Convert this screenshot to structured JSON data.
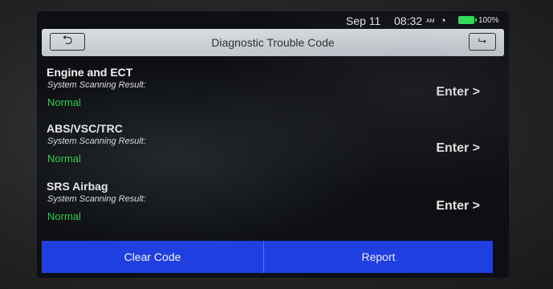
{
  "status": {
    "date": "Sep 11",
    "time": "08:32",
    "ampm": "AM",
    "wifi_icon": "wifi-icon",
    "battery_percent": "100%",
    "battery_color": "#2ee05a"
  },
  "header": {
    "title": "Diagnostic Trouble Code",
    "back_icon": "back-arrow-icon",
    "exit_icon": "exit-icon"
  },
  "systems": [
    {
      "name": "Engine and ECT",
      "label": "System Scanning Result:",
      "result": "Normal",
      "enter": "Enter >"
    },
    {
      "name": "ABS/VSC/TRC",
      "label": "System Scanning Result:",
      "result": "Normal",
      "enter": "Enter >"
    },
    {
      "name": "SRS Airbag",
      "label": "System Scanning Result:",
      "result": "Normal",
      "enter": "Enter >"
    }
  ],
  "footer": {
    "clear_label": "Clear Code",
    "report_label": "Report",
    "bar_color": "#1f3fe0"
  },
  "colors": {
    "normal_status": "#2bd14a"
  }
}
